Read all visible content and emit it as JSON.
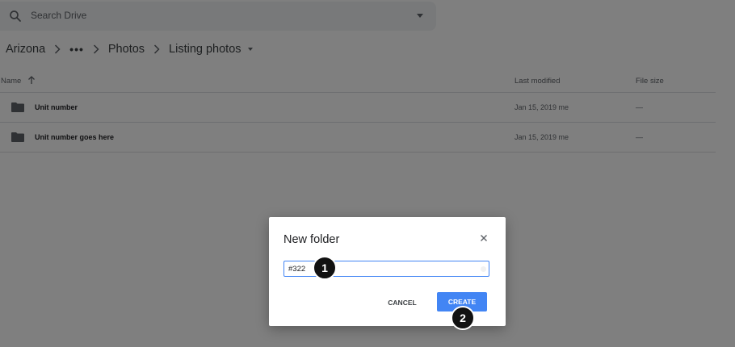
{
  "search": {
    "placeholder": "Search Drive"
  },
  "breadcrumb": {
    "items": [
      "Arizona",
      "Photos",
      "Listing photos"
    ],
    "more": "•••"
  },
  "table": {
    "headers": {
      "name": "Name",
      "modified": "Last modified",
      "size": "File size"
    },
    "rows": [
      {
        "name": "Unit number",
        "modified": "Jan 15, 2019 me",
        "size": "—"
      },
      {
        "name": "Unit number goes here",
        "modified": "Jan 15, 2019 me",
        "size": "—"
      }
    ]
  },
  "dialog": {
    "title": "New folder",
    "input_value": "#322",
    "cancel_label": "CANCEL",
    "create_label": "CREATE"
  },
  "markers": [
    "1",
    "2"
  ],
  "colors": {
    "accent": "#4285f4",
    "overlay": "rgba(0,0,0,0.5)"
  }
}
